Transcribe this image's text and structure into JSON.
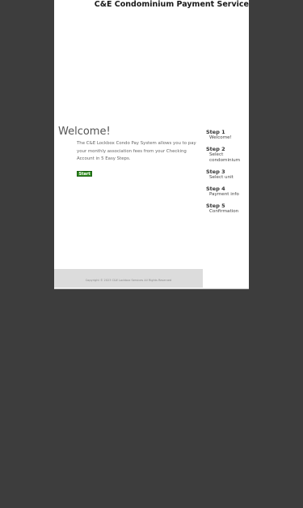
{
  "header": {
    "title": "C&E Condominium Payment Service"
  },
  "main": {
    "heading": "Welcome!",
    "intro": "The C&E Lockbox Condo Pay System allows you to pay your monthly association fees from your Checking Account in 5 Easy Steps.",
    "start_label": "Start"
  },
  "steps": [
    {
      "title": "Step 1",
      "desc": "Welcome!"
    },
    {
      "title": "Step 2",
      "desc": "Select condominium"
    },
    {
      "title": "Step 3",
      "desc": "Select unit"
    },
    {
      "title": "Step 4",
      "desc": "Payment info"
    },
    {
      "title": "Step 5",
      "desc": "Confirmation"
    }
  ],
  "footer": {
    "copyright": "Copyright © 2023 C&E Lockbox Services All Rights Reserved"
  },
  "colors": {
    "background": "#3d3d3d",
    "start_button": "#2e8b1e"
  }
}
